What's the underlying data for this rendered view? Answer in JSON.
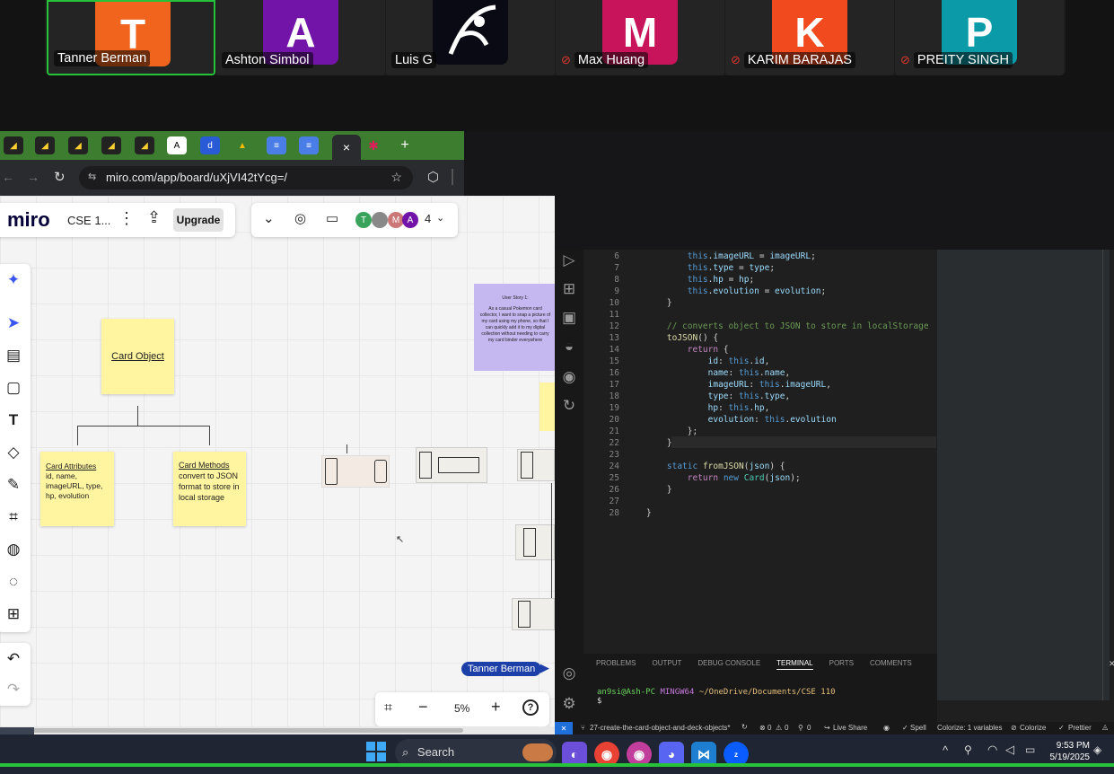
{
  "zoom": {
    "participants": [
      {
        "initial": "T",
        "name": "Tanner Berman",
        "color": "#f0641e",
        "muted": false,
        "active": true
      },
      {
        "initial": "A",
        "name": "Ashton Simbol",
        "color": "#7314a8",
        "muted": false,
        "active": false
      },
      {
        "initial": "",
        "name": "Luis G",
        "color": "#0a0a14",
        "muted": false,
        "active": false
      },
      {
        "initial": "M",
        "name": "Max Huang",
        "color": "#c8145a",
        "muted": true,
        "active": false
      },
      {
        "initial": "K",
        "name": "KARIM BARAJAS",
        "color": "#f04a1e",
        "muted": true,
        "active": false
      },
      {
        "initial": "P",
        "name": "PREITY SINGH",
        "color": "#0a9aa8",
        "muted": true,
        "active": false
      }
    ]
  },
  "browser": {
    "url": "miro.com/app/board/uXjVI42tYcg=/",
    "close_tab": "×",
    "new_tab": "+"
  },
  "miro": {
    "logo": "miro",
    "board_name": "CSE 1...",
    "upgrade": "Upgrade",
    "collab_count": "4",
    "collab_initials": [
      "T",
      "",
      "M",
      "A"
    ],
    "card_object": "Card Object",
    "attributes": {
      "title": "Card Attributes",
      "body": "id, name, imageURL, type, hp, evolution"
    },
    "methods": {
      "title": "Card Methods",
      "body": "convert to JSON format to store in local storage"
    },
    "story": {
      "title": "User Story 1:",
      "body": "As a casual Pokemon card collector, I want to snap a picture of my card using my phone, so that I can quickly add it to my digital collection without needing to carry my card binder everywhere"
    },
    "cursor_label": "Tanner Berman",
    "zoom": "5%"
  },
  "vscode": {
    "code_lines": [
      {
        "n": "6",
        "html": "        <span class='k'>this</span>.<span class='p'>imageURL</span> = <span class='p'>imageURL</span>;"
      },
      {
        "n": "7",
        "html": "        <span class='k'>this</span>.<span class='p'>type</span> = <span class='p'>type</span>;"
      },
      {
        "n": "8",
        "html": "        <span class='k'>this</span>.<span class='p'>hp</span> = <span class='p'>hp</span>;"
      },
      {
        "n": "9",
        "html": "        <span class='k'>this</span>.<span class='p'>evolution</span> = <span class='p'>evolution</span>;"
      },
      {
        "n": "10",
        "html": "    }"
      },
      {
        "n": "11",
        "html": ""
      },
      {
        "n": "12",
        "html": "    <span class='c'>// converts object to JSON to store in localStorage</span>"
      },
      {
        "n": "13",
        "html": "    <span class='f'>toJSON</span>() {"
      },
      {
        "n": "14",
        "html": "        <span class='y'>return</span> {"
      },
      {
        "n": "15",
        "html": "            <span class='p'>id</span>: <span class='k'>this</span>.<span class='p'>id</span>,"
      },
      {
        "n": "16",
        "html": "            <span class='p'>name</span>: <span class='k'>this</span>.<span class='p'>name</span>,"
      },
      {
        "n": "17",
        "html": "            <span class='p'>imageURL</span>: <span class='k'>this</span>.<span class='p'>imageURL</span>,"
      },
      {
        "n": "18",
        "html": "            <span class='p'>type</span>: <span class='k'>this</span>.<span class='p'>type</span>,"
      },
      {
        "n": "19",
        "html": "            <span class='p'>hp</span>: <span class='k'>this</span>.<span class='p'>hp</span>,"
      },
      {
        "n": "20",
        "html": "            <span class='p'>evolution</span>: <span class='k'>this</span>.<span class='p'>evolution</span>"
      },
      {
        "n": "21",
        "html": "        };"
      },
      {
        "n": "22",
        "html": "    }"
      },
      {
        "n": "23",
        "html": ""
      },
      {
        "n": "24",
        "html": "    <span class='k'>static</span> <span class='f'>fromJSON</span>(<span class='p'>json</span>) {"
      },
      {
        "n": "25",
        "html": "        <span class='y'>return</span> <span class='k'>new</span> <span class='t'>Card</span>(<span class='p'>json</span>);"
      },
      {
        "n": "26",
        "html": "    }"
      },
      {
        "n": "27",
        "html": ""
      },
      {
        "n": "28",
        "html": "}"
      }
    ],
    "panel_tabs": [
      "PROBLEMS",
      "OUTPUT",
      "DEBUG CONSOLE",
      "TERMINAL",
      "PORTS",
      "COMMENTS"
    ],
    "active_panel": "TERMINAL",
    "terminal_user": "an9si@Ash-PC",
    "terminal_env": "MINGW64",
    "terminal_path": "~/OneDrive/Documents/CSE 110",
    "terminal_prompt": "$",
    "status": {
      "branch": "27-create-the-card-object-and-deck-objects*",
      "errors": "0",
      "warnings": "0",
      "ports": "0",
      "live_share": "Live Share",
      "spell": "Spell",
      "colorize_vars": "Colorize: 1 variables",
      "colorize": "Colorize",
      "prettier": "Prettier"
    }
  },
  "taskbar": {
    "search": "Search",
    "time": "9:53 PM",
    "date": "5/19/2025"
  }
}
